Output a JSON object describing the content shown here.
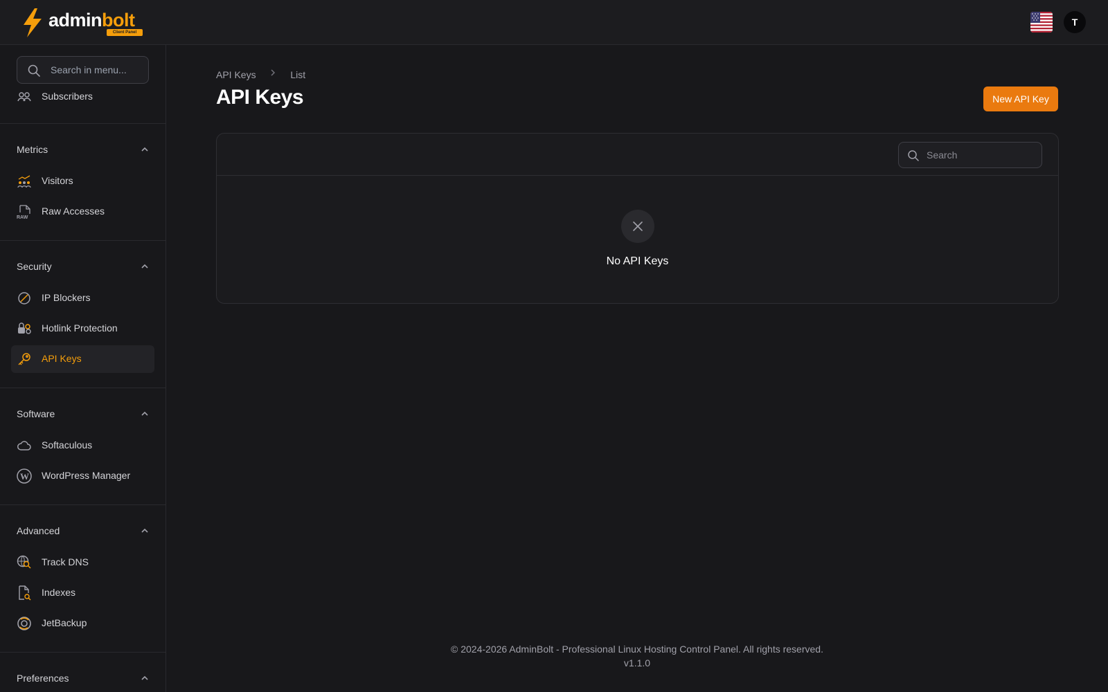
{
  "header": {
    "logo_word_1": "admin",
    "logo_word_2": "bolt",
    "logo_badge": "Client Panel",
    "avatar_initial": "T",
    "language_flag": "us-flag-icon",
    "accent_color": "#f59e0b"
  },
  "sidebar": {
    "search_placeholder": "Search in menu...",
    "items_top": [
      {
        "label": "Subscribers",
        "icon": "subscribers-icon"
      }
    ],
    "groups": [
      {
        "label": "Metrics",
        "items": [
          {
            "label": "Visitors",
            "icon": "visitors-icon"
          },
          {
            "label": "Raw Accesses",
            "icon": "raw-file-icon"
          }
        ]
      },
      {
        "label": "Security",
        "items": [
          {
            "label": "IP Blockers",
            "icon": "block-icon"
          },
          {
            "label": "Hotlink Protection",
            "icon": "hotlink-icon"
          },
          {
            "label": "API Keys",
            "icon": "key-icon",
            "active": true
          }
        ]
      },
      {
        "label": "Software",
        "items": [
          {
            "label": "Softaculous",
            "icon": "cloud-icon"
          },
          {
            "label": "WordPress Manager",
            "icon": "wordpress-icon"
          }
        ]
      },
      {
        "label": "Advanced",
        "items": [
          {
            "label": "Track DNS",
            "icon": "dns-search-icon"
          },
          {
            "label": "Indexes",
            "icon": "file-search-icon"
          },
          {
            "label": "JetBackup",
            "icon": "backup-icon"
          }
        ]
      },
      {
        "label": "Preferences",
        "items": []
      }
    ]
  },
  "main": {
    "breadcrumb": [
      "API Keys",
      "List"
    ],
    "title": "API Keys",
    "new_button": "New API Key",
    "table_search_placeholder": "Search",
    "empty_text": "No API Keys"
  },
  "footer": {
    "copyright": "© 2024-2026 AdminBolt - Professional Linux Hosting Control Panel. All rights reserved.",
    "version": "v1.1.0"
  }
}
